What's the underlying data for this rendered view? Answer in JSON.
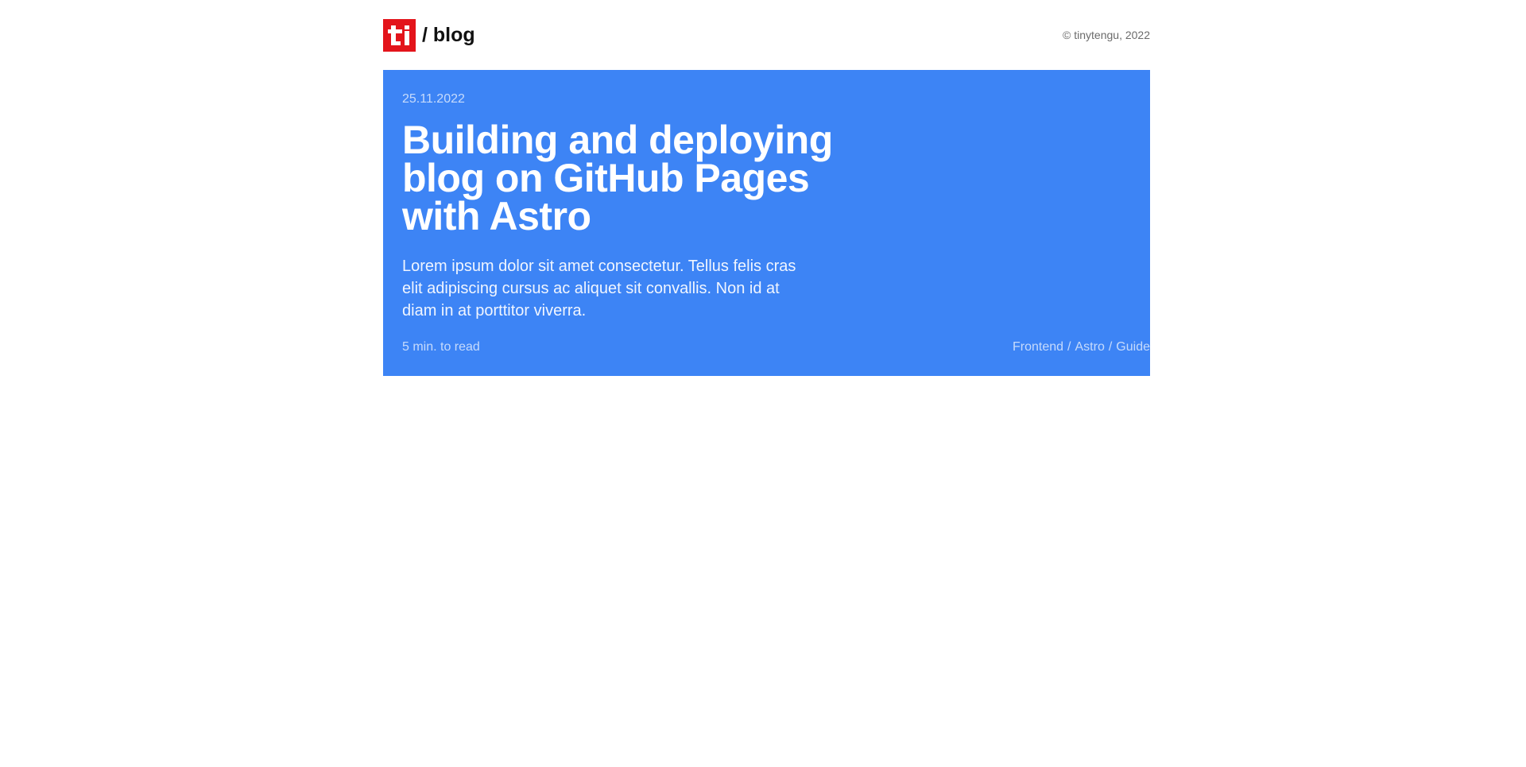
{
  "header": {
    "logo_text": "ti",
    "brand_label": "/ blog",
    "copyright": "© tinytengu, 2022"
  },
  "post": {
    "date": "25.11.2022",
    "title": "Building and deploying blog on GitHub Pages with Astro",
    "excerpt": "Lorem ipsum dolor sit amet consectetur. Tellus felis cras elit adipiscing cursus ac aliquet sit convallis. Non id at diam in at porttitor viverra.",
    "read_time": "5 min. to read",
    "tags": [
      "Frontend",
      "Astro",
      "Guide"
    ],
    "tag_separator": "/"
  },
  "colors": {
    "logo_red": "#e3141b",
    "card_blue": "#3d84f5",
    "text_dark": "#111111",
    "text_muted": "#6b6b6b"
  }
}
